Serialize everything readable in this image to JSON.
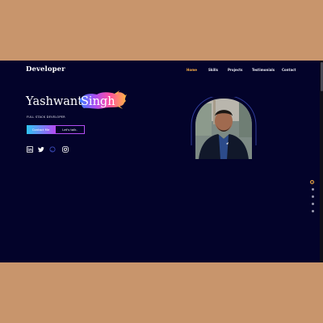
{
  "brand": "Developer",
  "nav": [
    {
      "label": "Home",
      "active": true
    },
    {
      "label": "Skills",
      "active": false
    },
    {
      "label": "Projects",
      "active": false
    },
    {
      "label": "Testimonials",
      "active": false
    },
    {
      "label": "Contact",
      "active": false
    }
  ],
  "hero": {
    "first_name": "Yashwant",
    "last_name": "Singh",
    "role": "FULL STACK DEVELOPER",
    "contact_button": "Contact Me",
    "talk_button": "Let's talk."
  },
  "social": [
    "linkedin-icon",
    "twitter-icon",
    "github-icon",
    "instagram-icon"
  ],
  "section_dots": {
    "count": 5,
    "active_index": 0
  },
  "colors": {
    "background": "#03032a",
    "accent": "#ffb347",
    "gradient_start": "#2ec5f5",
    "gradient_end": "#b24cf3",
    "page_border": "#c8956c"
  }
}
